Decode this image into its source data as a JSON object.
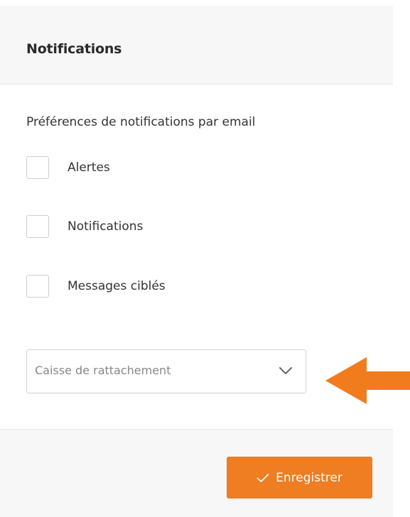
{
  "header": {
    "title": "Notifications"
  },
  "email_preferences": {
    "label": "Préférences de notifications par email",
    "options": [
      {
        "label": "Alertes",
        "checked": false
      },
      {
        "label": "Notifications",
        "checked": false
      },
      {
        "label": "Messages ciblés",
        "checked": false
      }
    ]
  },
  "caisse_select": {
    "placeholder": "Caisse de rattachement",
    "icon": "chevron-down-icon"
  },
  "annotation": {
    "icon": "arrow-left-icon",
    "color": "#f07c1d"
  },
  "footer": {
    "save_label": "Enregistrer",
    "save_icon": "check-icon",
    "accent": "#ef7d22"
  }
}
